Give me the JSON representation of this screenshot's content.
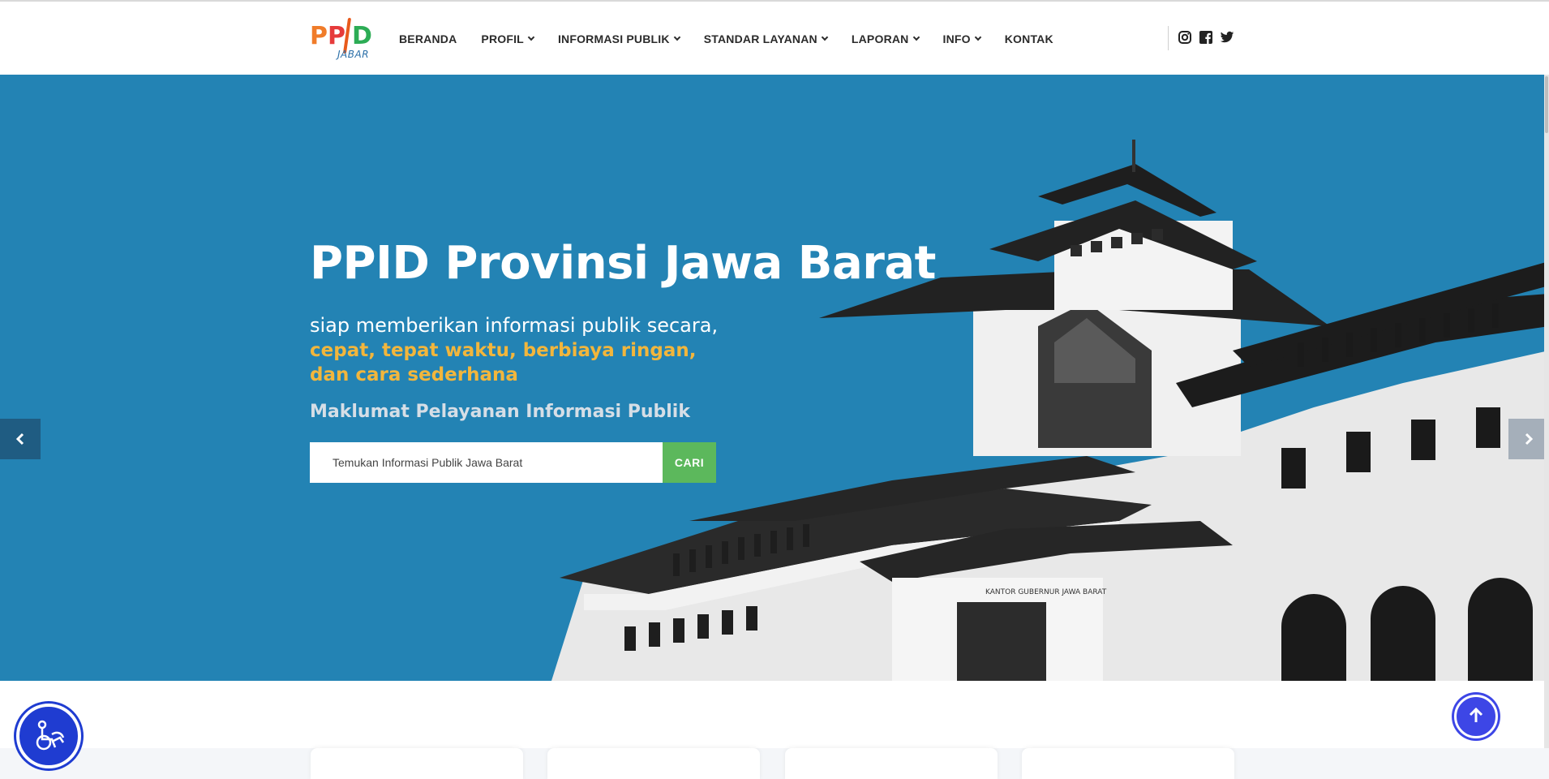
{
  "logo": {
    "letters": [
      "P",
      "P",
      "D"
    ],
    "subtitle": "JABAR",
    "colors": {
      "p1": "#f07c2a",
      "p2": "#e63b3b",
      "d": "#2cac55",
      "jabar": "#2b6fa8"
    }
  },
  "nav": {
    "items": [
      {
        "label": "BERANDA",
        "dropdown": false
      },
      {
        "label": "PROFIL",
        "dropdown": true
      },
      {
        "label": "INFORMASI PUBLIK",
        "dropdown": true
      },
      {
        "label": "STANDAR LAYANAN",
        "dropdown": true
      },
      {
        "label": "LAPORAN",
        "dropdown": true
      },
      {
        "label": "INFO",
        "dropdown": true
      },
      {
        "label": "KONTAK",
        "dropdown": false
      }
    ],
    "social_icons": [
      "instagram-icon",
      "facebook-icon",
      "twitter-icon"
    ]
  },
  "hero": {
    "title": "PPID Provinsi Jawa Barat",
    "subtitle_line1": "siap memberikan informasi publik secara,",
    "subtitle_highlight": "cepat, tepat waktu, berbiaya ringan, dan cara sederhana",
    "maklumat_link": "Maklumat Pelayanan Informasi Publik",
    "search": {
      "placeholder": "Temukan Informasi Publik Jawa Barat",
      "button_label": "CARI"
    },
    "building_sign": "KANTOR GUBERNUR JAWA BARAT",
    "background_color": "#2383b4",
    "highlight_color": "#f2b63c",
    "button_color": "#5cb85c"
  },
  "floating": {
    "accessibility_icon": "wheelchair-icon",
    "scroll_top_icon": "arrow-up-icon",
    "accessibility_color": "#1f3cd1",
    "scroll_top_color": "#3d46e6"
  }
}
